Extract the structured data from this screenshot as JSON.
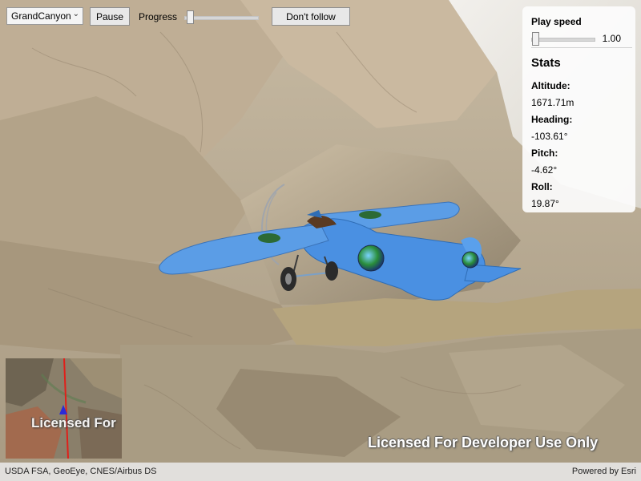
{
  "toolbar": {
    "mission_select": {
      "value": "GrandCanyon",
      "icon": "chevron-down-icon"
    },
    "pause_label": "Pause",
    "progress_label": "Progress",
    "progress_value": 0.04,
    "follow_label": "Don't follow"
  },
  "panel": {
    "play_speed_label": "Play speed",
    "play_speed_value": "1.00",
    "play_speed_fraction": 0.02,
    "stats_title": "Stats",
    "altitude_label": "Altitude:",
    "altitude_value": "1671.71m",
    "heading_label": "Heading:",
    "heading_value": "-103.61°",
    "pitch_label": "Pitch:",
    "pitch_value": "-4.62°",
    "roll_label": "Roll:",
    "roll_value": "19.87°"
  },
  "map": {
    "watermark": "Licensed For Developer Use Only",
    "inset_watermark": "Licensed For",
    "attribution": "USDA FSA, GeoEye, CNES/Airbus DS",
    "powered_by": "Powered by Esri"
  },
  "colors": {
    "aircraft": "#4a90e2",
    "route": "#e0201a",
    "river": "#b5a47e"
  }
}
